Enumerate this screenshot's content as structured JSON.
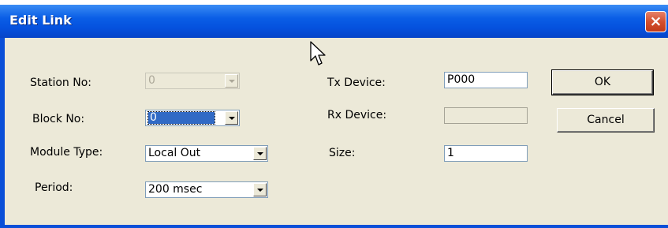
{
  "window": {
    "title": "Edit Link",
    "close_glyph": "×"
  },
  "left": {
    "station_no": {
      "label": "Station No:",
      "value": "0"
    },
    "block_no": {
      "label": "Block No:",
      "value": "0"
    },
    "module_type": {
      "label": "Module Type:",
      "value": "Local Out"
    },
    "period": {
      "label": "Period:",
      "value": "200 msec"
    }
  },
  "right": {
    "tx_device": {
      "label": "Tx Device:",
      "value": "P000"
    },
    "rx_device": {
      "label": "Rx Device:",
      "value": ""
    },
    "size": {
      "label": "Size:",
      "value": "1"
    }
  },
  "buttons": {
    "ok": "OK",
    "cancel": "Cancel"
  },
  "icons": {
    "close": "close-icon",
    "cursor": "mouse-pointer-icon",
    "dropdown": "chevron-down-icon"
  },
  "colors": {
    "titlebar": "#0551de",
    "dialog_bg": "#ece9d8",
    "close_button": "#d3502f",
    "selection": "#316ac5"
  }
}
